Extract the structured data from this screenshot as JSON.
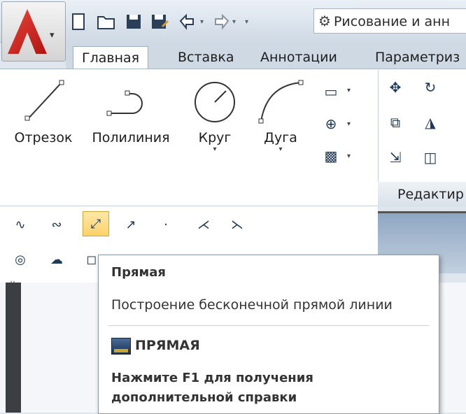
{
  "quick_access": {
    "workspace_label": "Рисование и анн",
    "icons": [
      "new-icon",
      "open-icon",
      "save-icon",
      "save-as-icon",
      "undo-icon",
      "redo-icon",
      "gear-icon"
    ]
  },
  "tabs": [
    {
      "label": "Главная",
      "active": true
    },
    {
      "label": "Вставка"
    },
    {
      "label": "Аннотации"
    },
    {
      "label": "Параметриз"
    }
  ],
  "draw_tools": [
    {
      "label": "Отрезок"
    },
    {
      "label": "Полилиния"
    },
    {
      "label": "Круг"
    },
    {
      "label": "Дуга"
    }
  ],
  "edit_panel": {
    "label": "Редактир"
  },
  "tooltip": {
    "title": "Прямая",
    "description": "Построение бесконечной прямой линии",
    "command": "ПРЯМАЯ",
    "help": "Нажмите F1 для получения\nдополнительной справки"
  },
  "colors": {
    "accent": "#fbd26a",
    "brand": "#c4211b"
  }
}
